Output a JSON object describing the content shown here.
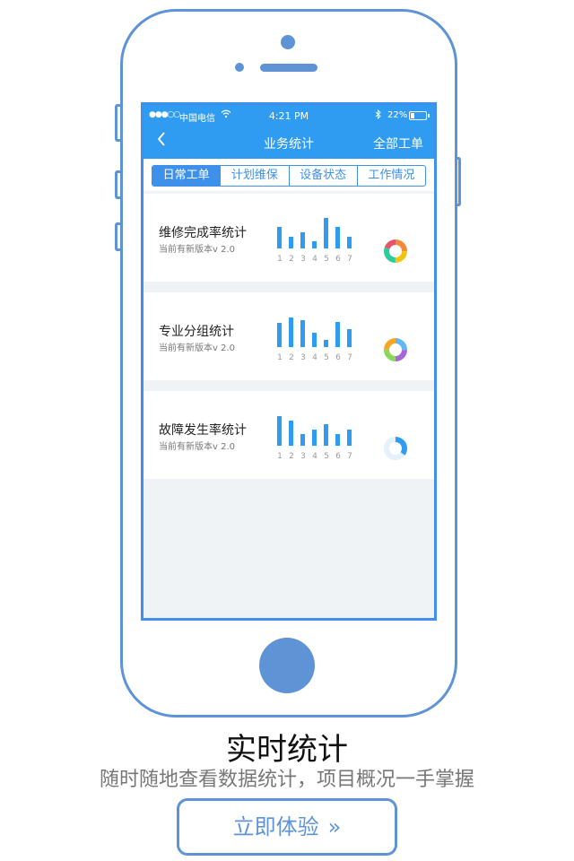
{
  "status_bar": {
    "signal": "●●●○○",
    "carrier": "中国电信",
    "wifi_icon": "wifi-icon",
    "time": "4:21 PM",
    "bluetooth_icon": "bluetooth-icon",
    "battery_percent": "22%",
    "battery_level": 0.22
  },
  "nav": {
    "back_glyph": "‹",
    "title": "业务统计",
    "right_label": "全部工单"
  },
  "tabs": [
    {
      "label": "日常工单",
      "active": true
    },
    {
      "label": "计划维保",
      "active": false
    },
    {
      "label": "设备状态",
      "active": false
    },
    {
      "label": "工作情况",
      "active": false
    }
  ],
  "cards": [
    {
      "title": "维修完成率统计",
      "subtitle": "当前有新版本v 2.0",
      "bar_values": [
        0.68,
        0.36,
        0.5,
        0.22,
        0.94,
        0.67,
        0.36
      ],
      "x_labels": [
        "1",
        "2",
        "3",
        "4",
        "5",
        "6",
        "7"
      ],
      "donut": [
        {
          "value": 0.25,
          "color": "#f08a3c"
        },
        {
          "value": 0.25,
          "color": "#f1c40f"
        },
        {
          "value": 0.3,
          "color": "#2ecc9a"
        },
        {
          "value": 0.2,
          "color": "#e5566b"
        }
      ]
    },
    {
      "title": "专业分组统计",
      "subtitle": "当前有新版本v 2.0",
      "bar_values": [
        0.75,
        0.92,
        0.82,
        0.44,
        0.22,
        0.78,
        0.56
      ],
      "x_labels": [
        "1",
        "2",
        "3",
        "4",
        "5",
        "6",
        "7"
      ],
      "donut": [
        {
          "value": 0.25,
          "color": "#5fb6f0"
        },
        {
          "value": 0.25,
          "color": "#a569d6"
        },
        {
          "value": 0.25,
          "color": "#8cd65a"
        },
        {
          "value": 0.25,
          "color": "#f5a623"
        }
      ]
    },
    {
      "title": "故障发生率统计",
      "subtitle": "当前有新版本v 2.0",
      "bar_values": [
        0.92,
        0.78,
        0.36,
        0.5,
        0.68,
        0.36,
        0.5
      ],
      "x_labels": [
        "1",
        "2",
        "3",
        "4",
        "5",
        "6",
        "7"
      ],
      "donut": [
        {
          "value": 0.35,
          "color": "#2f9cf2"
        },
        {
          "value": 0.65,
          "color": "#e3f1fc"
        }
      ]
    }
  ],
  "headline": "实时统计",
  "tagline": "随时随地查看数据统计，项目概况一手掌握",
  "cta": {
    "label": "立即体验",
    "arrow": "»"
  },
  "colors": {
    "accent": "#2f9cf2",
    "frame": "#5e93d6"
  }
}
